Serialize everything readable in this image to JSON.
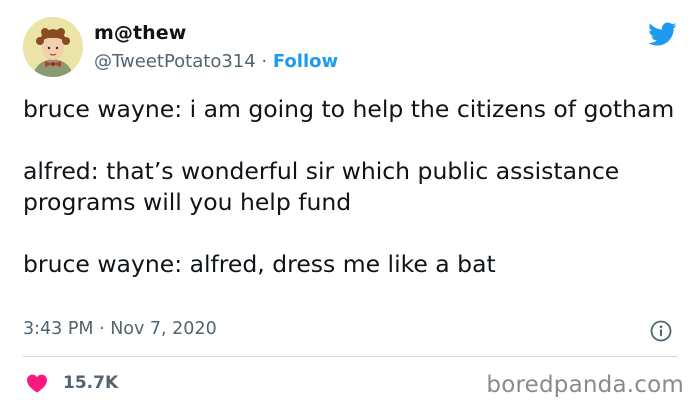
{
  "tweet": {
    "author": {
      "display_name": "m@thew",
      "handle": "@TweetPotato314",
      "separator": " · ",
      "follow_label": "Follow"
    },
    "paragraphs": [
      "bruce wayne: i am going to help the citizens of gotham",
      "alfred: that’s wonderful sir which public assistance programs will you help fund",
      "bruce wayne: alfred, dress me like a bat"
    ],
    "timestamp": "3:43 PM · Nov 7, 2020",
    "likes": "15.7K"
  },
  "watermark": "boredpanda.com",
  "colors": {
    "accent": "#1d9bf0",
    "heart": "#f91880",
    "text": "#0f1419",
    "secondary_text": "#536471",
    "divider": "#cfd9de"
  },
  "icons": {
    "logo": "twitter-bird-icon",
    "info": "info-icon",
    "like": "heart-icon"
  }
}
